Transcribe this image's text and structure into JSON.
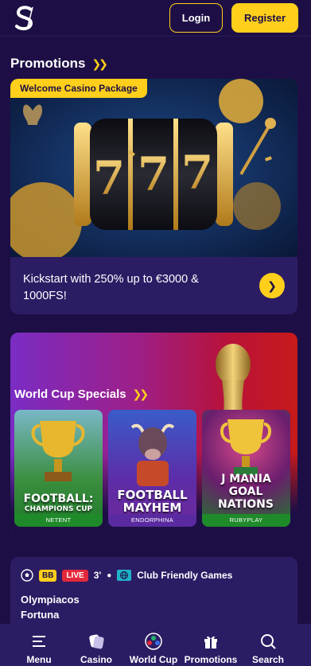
{
  "header": {
    "logo_icon": "s-logo-icon",
    "login_label": "Login",
    "register_label": "Register",
    "accent_color": "#ffcf1b"
  },
  "promotions": {
    "title": "Promotions",
    "card": {
      "badge": "Welcome Casino Package",
      "image_icon": "slot-777-icon",
      "text": "Kickstart with 250% up to €3000 & 1000FS!",
      "arrow_icon": "chevron-right-icon"
    }
  },
  "world_cup": {
    "title": "World Cup Specials",
    "games": [
      {
        "title_line1": "FOOTBALL:",
        "title_line2": "CHAMPIONS CUP",
        "provider": "NETENT"
      },
      {
        "title_line1": "FOOTBALL",
        "title_line2": "MAYHEM",
        "provider": "ENDORPHINA"
      },
      {
        "title_line1": "J MANIA",
        "title_line2": "GOAL NATIONS",
        "provider": "RUBYPLAY"
      }
    ]
  },
  "match": {
    "bb": "BB",
    "live": "LIVE",
    "minute": "3'",
    "league": "Club Friendly Games",
    "team1": "Olympiacos",
    "team2": "Fortuna"
  },
  "nav": {
    "items": [
      {
        "label": "Menu",
        "icon": "menu-icon"
      },
      {
        "label": "Casino",
        "icon": "casino-chip-icon"
      },
      {
        "label": "World Cup",
        "icon": "soccer-ball-icon"
      },
      {
        "label": "Promotions",
        "icon": "gift-icon"
      },
      {
        "label": "Search",
        "icon": "search-icon"
      }
    ]
  }
}
